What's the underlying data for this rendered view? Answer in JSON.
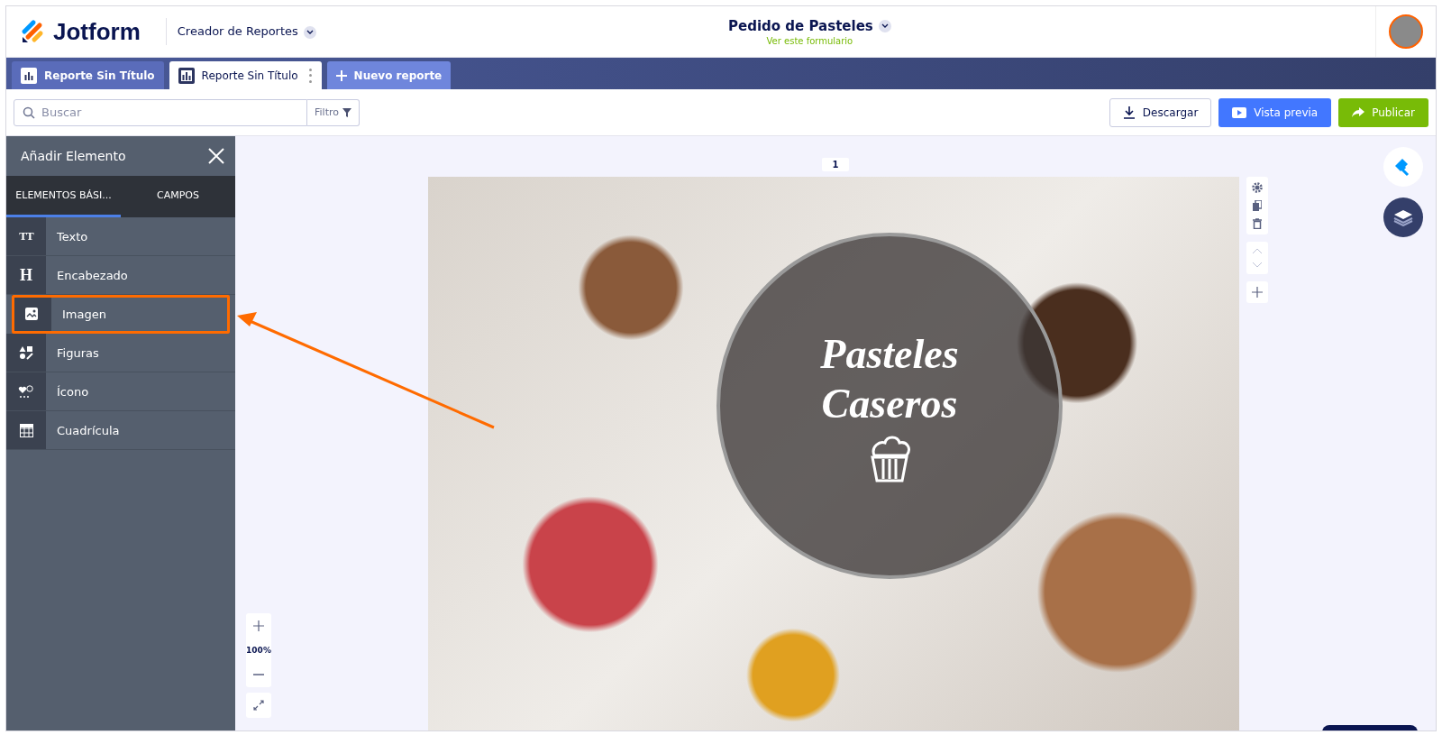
{
  "header": {
    "brand": "Jotform",
    "product": "Creador de Reportes",
    "form_title": "Pedido de Pasteles",
    "form_link": "Ver este formulario"
  },
  "report_tabs": [
    {
      "label": "Reporte Sin Título",
      "selected": false
    },
    {
      "label": "Reporte Sin Título",
      "selected": true
    }
  ],
  "new_report": {
    "label": "Nuevo reporte"
  },
  "toolbar": {
    "search": {
      "placeholder": "Buscar"
    },
    "filter": "Filtro",
    "buttons": [
      {
        "label": "Descargar",
        "kind": "outline"
      },
      {
        "label": "Vista previa",
        "kind": "primary"
      },
      {
        "label": "Publicar",
        "kind": "success"
      }
    ]
  },
  "panel": {
    "title": "Añadir Elemento",
    "tabs": [
      {
        "label": "ELEMENTOS BÁSI...",
        "selected": true
      },
      {
        "label": "CAMPOS",
        "selected": false
      }
    ],
    "items": [
      {
        "label": "Texto",
        "glyph": "TT",
        "highlighted": false
      },
      {
        "label": "Encabezado",
        "glyph": "H",
        "highlighted": false
      },
      {
        "label": "Imagen",
        "highlighted": true
      },
      {
        "label": "Figuras",
        "highlighted": false
      },
      {
        "label": "Ícono",
        "highlighted": false
      },
      {
        "label": "Cuadrícula",
        "highlighted": false
      }
    ]
  },
  "canvas": {
    "page_number": "1",
    "title_lines": [
      "Pasteles",
      "Caseros"
    ],
    "zoom": "100%"
  }
}
